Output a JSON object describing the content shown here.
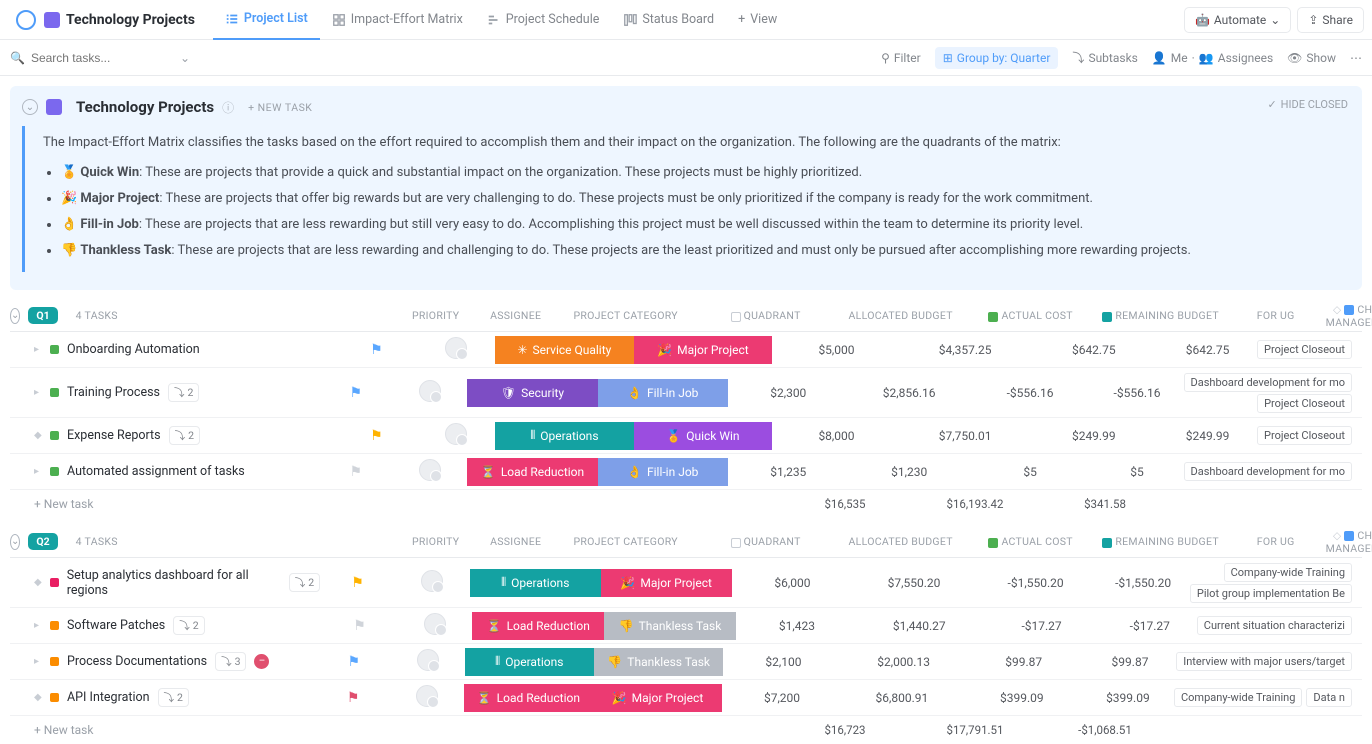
{
  "header": {
    "page_title": "Technology Projects",
    "tabs": [
      {
        "label": "Project List",
        "active": true
      },
      {
        "label": "Impact-Effort Matrix"
      },
      {
        "label": "Project Schedule"
      },
      {
        "label": "Status Board"
      },
      {
        "label": "View"
      }
    ],
    "automate": "Automate",
    "share": "Share"
  },
  "toolbar": {
    "search_placeholder": "Search tasks...",
    "filter": "Filter",
    "group_by": "Group by: Quarter",
    "subtasks": "Subtasks",
    "me": "Me",
    "assignees": "Assignees",
    "show": "Show"
  },
  "description": {
    "title": "Technology Projects",
    "new_task": "+ NEW TASK",
    "hide_closed": "HIDE CLOSED",
    "intro": "The Impact-Effort Matrix classifies the tasks based on the effort required to accomplish them and their impact on the organization. The following are the quadrants of the matrix:",
    "bullets": [
      {
        "icon": "🏅",
        "name": "Quick Win",
        "text": ": These are projects that provide a quick and substantial impact on the organization. These projects must be highly prioritized."
      },
      {
        "icon": "🎉",
        "name": "Major Project",
        "text": ": These are projects that offer big rewards but are very challenging to do. These projects must be only prioritized if the company is ready for the work commitment."
      },
      {
        "icon": "👌",
        "name": "Fill-in Job",
        "text": ": These are projects that are less rewarding but still very easy to do. Accomplishing this project must be well discussed within the team to determine its priority level."
      },
      {
        "icon": "👎",
        "name": "Thankless Task",
        "text": ": These are projects that are less rewarding and challenging to do. These projects are the least prioritized and must only be pursued after accomplishing more rewarding projects."
      }
    ]
  },
  "columns": {
    "tasks_suffix": "TASKS",
    "priority": "PRIORITY",
    "assignee": "ASSIGNEE",
    "category": "PROJECT CATEGORY",
    "quadrant": "QUADRANT",
    "allocated": "ALLOCATED BUDGET",
    "actual": "ACTUAL COST",
    "remaining": "REMAINING BUDGET",
    "for_ug": "FOR UG",
    "change": "CHANGE MANAGEMENT"
  },
  "new_task_label": "+ New task",
  "colors": {
    "svc_quality": "#f58220",
    "security": "#7d4dc4",
    "operations": "#14a2a2",
    "load_red": "#ec3a72",
    "major": "#ec3a72",
    "fillin": "#7e9fe8",
    "quickwin": "#9b4de0",
    "thankless": "#b7bcc4",
    "q1": "#14a2a2",
    "q2": "#14a2a2"
  },
  "groups": [
    {
      "id": "Q1",
      "label": "Q1",
      "count": "4",
      "badge_color": "#14a2a2",
      "rows": [
        {
          "status": "green-dot",
          "name": "Onboarding Automation",
          "sub": "",
          "flag": "#5aa7ff",
          "cat": {
            "txt": "Service Quality",
            "icon": "✳",
            "bg": "svc_quality"
          },
          "quad": {
            "txt": "Major Project",
            "icon": "🎉",
            "bg": "major"
          },
          "alloc": "$5,000",
          "actual": "$4,357.25",
          "remain": "$642.75",
          "ug": "$642.75",
          "chg": [
            "Project Closeout"
          ]
        },
        {
          "status": "green-dot",
          "name": "Training Process",
          "sub": "2",
          "flag": "#5aa7ff",
          "cat": {
            "txt": "Security",
            "icon": "🛡",
            "bg": "security"
          },
          "quad": {
            "txt": "Fill-in Job",
            "icon": "👌",
            "bg": "fillin"
          },
          "alloc": "$2,300",
          "actual": "$2,856.16",
          "remain": "-$556.16",
          "ug": "-$556.16",
          "chg": [
            "Dashboard development for mo",
            "Project Closeout"
          ],
          "tall": true
        },
        {
          "status": "green-dot",
          "caret": "◆",
          "name": "Expense Reports",
          "sub": "2",
          "flag": "#ffb300",
          "cat": {
            "txt": "Operations",
            "icon": "⫴",
            "bg": "operations"
          },
          "quad": {
            "txt": "Quick Win",
            "icon": "🏅",
            "bg": "quickwin"
          },
          "alloc": "$8,000",
          "actual": "$7,750.01",
          "remain": "$249.99",
          "ug": "$249.99",
          "chg": [
            "Project Closeout"
          ]
        },
        {
          "status": "green-dot",
          "name": "Automated assignment of tasks",
          "sub": "",
          "flag": "#d0d4da",
          "cat": {
            "txt": "Load Reduction",
            "icon": "⏳",
            "bg": "load_red"
          },
          "quad": {
            "txt": "Fill-in Job",
            "icon": "👌",
            "bg": "fillin"
          },
          "alloc": "$1,235",
          "actual": "$1,230",
          "remain": "$5",
          "ug": "$5",
          "chg": [
            "Dashboard development for mo"
          ]
        }
      ],
      "sum": {
        "alloc": "$16,535",
        "actual": "$16,193.42",
        "remain": "$341.58"
      }
    },
    {
      "id": "Q2",
      "label": "Q2",
      "count": "4",
      "badge_color": "#14a2a2",
      "rows": [
        {
          "status": "pink-dot",
          "caret": "◆",
          "name": "Setup analytics dashboard for all regions",
          "sub": "2",
          "flag": "#ffb300",
          "cat": {
            "txt": "Operations",
            "icon": "⫴",
            "bg": "operations"
          },
          "quad": {
            "txt": "Major Project",
            "icon": "🎉",
            "bg": "major"
          },
          "alloc": "$6,000",
          "actual": "$7,550.20",
          "remain": "-$1,550.20",
          "ug": "-$1,550.20",
          "chg": [
            "Company-wide Training",
            "Pilot group implementation    Be"
          ],
          "tall": true
        },
        {
          "status": "orange-dot",
          "name": "Software Patches",
          "sub": "2",
          "flag": "#d0d4da",
          "cat": {
            "txt": "Load Reduction",
            "icon": "⏳",
            "bg": "load_red"
          },
          "quad": {
            "txt": "Thankless Task",
            "icon": "👎",
            "bg": "thankless"
          },
          "alloc": "$1,423",
          "actual": "$1,440.27",
          "remain": "-$17.27",
          "ug": "-$17.27",
          "chg": [
            "Current situation characterizi"
          ]
        },
        {
          "status": "orange-dot",
          "name": "Process Documentations",
          "sub": "3",
          "blocked": true,
          "flag": "#5aa7ff",
          "cat": {
            "txt": "Operations",
            "icon": "⫴",
            "bg": "operations"
          },
          "quad": {
            "txt": "Thankless Task",
            "icon": "👎",
            "bg": "thankless"
          },
          "alloc": "$2,100",
          "actual": "$2,000.13",
          "remain": "$99.87",
          "ug": "$99.87",
          "chg": [
            "Interview with major users/target"
          ]
        },
        {
          "status": "orange-dot",
          "caret": "◆",
          "name": "API Integration",
          "sub": "2",
          "flag": "#e04f6e",
          "cat": {
            "txt": "Load Reduction",
            "icon": "⏳",
            "bg": "load_red"
          },
          "quad": {
            "txt": "Major Project",
            "icon": "🎉",
            "bg": "major"
          },
          "alloc": "$7,200",
          "actual": "$6,800.91",
          "remain": "$399.09",
          "ug": "$399.09",
          "chg": [
            "Company-wide Training",
            "Data n"
          ],
          "chg_inline": true
        }
      ],
      "sum": {
        "alloc": "$16,723",
        "actual": "$17,791.51",
        "remain": "-$1,068.51"
      }
    }
  ]
}
